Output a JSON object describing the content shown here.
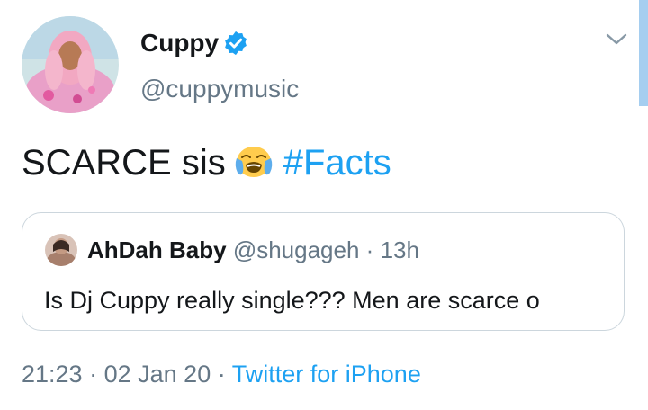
{
  "author": {
    "name": "Cuppy",
    "handle": "@cuppymusic",
    "verified": true,
    "avatar_icon": "profile-photo"
  },
  "tweet": {
    "text": "SCARCE sis",
    "emoji": "loudly-crying-face-emoji",
    "hashtag": "#Facts"
  },
  "quoted_tweet": {
    "author_name": "AhDah Baby",
    "author_handle": "@shugageh",
    "separator": "·",
    "time": "13h",
    "text": "Is Dj Cuppy really single??? Men are scarce o"
  },
  "meta": {
    "time": "21:23",
    "separator": "·",
    "date": "02 Jan 20",
    "source": "Twitter for iPhone"
  },
  "colors": {
    "link": "#1da1f2",
    "secondary_text": "#657786",
    "primary_text": "#14171a",
    "border": "#ccd6dd"
  }
}
